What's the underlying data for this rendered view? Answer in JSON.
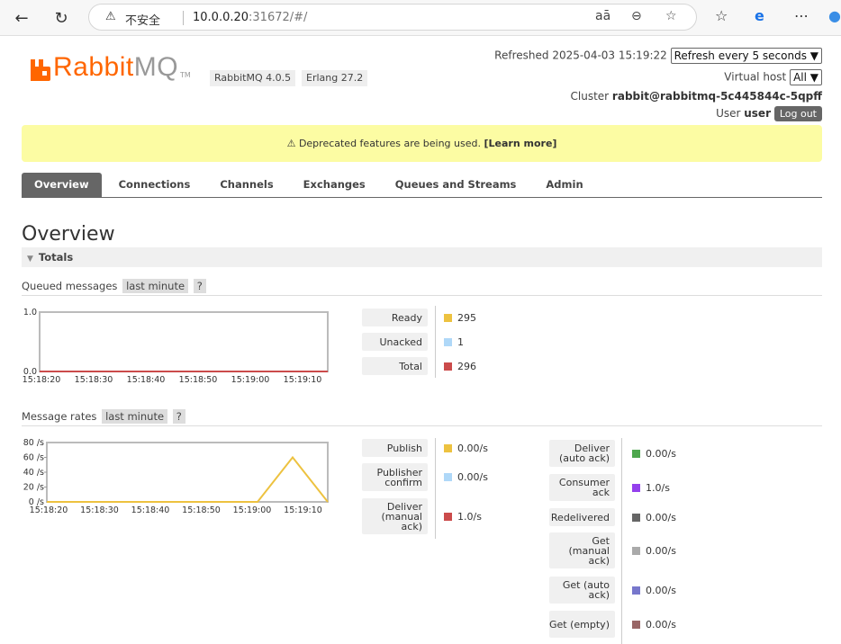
{
  "browser": {
    "insecure_label": "不安全",
    "url_host": "10.0.0.20",
    "url_rest": ":31672/#/"
  },
  "header": {
    "logo_rabbit": "Rabbit",
    "logo_mq": "MQ",
    "logo_tm": "TM",
    "rabbit_version": "RabbitMQ 4.0.5",
    "erlang_version": "Erlang 27.2",
    "refreshed_label": "Refreshed",
    "refreshed_time": "2025-04-03 15:19:22",
    "refresh_select": "Refresh every 5 seconds",
    "vhost_label": "Virtual host",
    "vhost_select": "All",
    "cluster_label": "Cluster",
    "cluster_name": "rabbit@rabbitmq-5c445844c-5qpff",
    "user_label": "User",
    "user_name": "user",
    "logout_label": "Log out"
  },
  "banner": {
    "icon": "⚠",
    "text": "Deprecated features are being used.",
    "link": "[Learn more]"
  },
  "tabs": [
    {
      "label": "Overview",
      "active": true
    },
    {
      "label": "Connections"
    },
    {
      "label": "Channels"
    },
    {
      "label": "Exchanges"
    },
    {
      "label": "Queues and Streams"
    },
    {
      "label": "Admin"
    }
  ],
  "page_title": "Overview",
  "totals_label": "Totals",
  "queued": {
    "heading": "Queued messages",
    "range": "last minute",
    "help": "?",
    "stats": [
      {
        "label": "Ready",
        "value": "295",
        "color": "#edc240"
      },
      {
        "label": "Unacked",
        "value": "1",
        "color": "#afd8f8"
      },
      {
        "label": "Total",
        "value": "296",
        "color": "#cb4b4b"
      }
    ]
  },
  "rates": {
    "heading": "Message rates",
    "range": "last minute",
    "help": "?",
    "left_stats": [
      {
        "label": "Publish",
        "value": "0.00/s",
        "color": "#edc240"
      },
      {
        "label": "Publisher confirm",
        "value": "0.00/s",
        "color": "#afd8f8"
      },
      {
        "label": "Deliver (manual ack)",
        "value": "1.0/s",
        "color": "#cb4b4b"
      }
    ],
    "right_stats": [
      {
        "label": "Deliver (auto ack)",
        "value": "0.00/s",
        "color": "#4da74d"
      },
      {
        "label": "Consumer ack",
        "value": "1.0/s",
        "color": "#9440ed"
      },
      {
        "label": "Redelivered",
        "value": "0.00/s",
        "color": "#666666"
      },
      {
        "label": "Get (manual ack)",
        "value": "0.00/s",
        "color": "#aaaaaa"
      },
      {
        "label": "Get (auto ack)",
        "value": "0.00/s",
        "color": "#7777cc"
      },
      {
        "label": "Get (empty)",
        "value": "0.00/s",
        "color": "#996666"
      }
    ]
  },
  "chart_data": [
    {
      "type": "line",
      "x": [
        "15:18:20",
        "15:18:30",
        "15:18:40",
        "15:18:50",
        "15:19:00",
        "15:19:10"
      ],
      "y_ticks": [
        "1.0",
        "0.0"
      ],
      "ylim": [
        0,
        1
      ],
      "series": [
        {
          "name": "Total",
          "color": "#cb4b4b",
          "values": [
            0,
            0,
            0,
            0,
            0,
            0
          ]
        }
      ]
    },
    {
      "type": "line",
      "x": [
        "15:18:20",
        "15:18:30",
        "15:18:40",
        "15:18:50",
        "15:19:00",
        "15:19:10"
      ],
      "y_ticks": [
        "80 /s",
        "60 /s",
        "40 /s",
        "20 /s",
        "0 /s"
      ],
      "ylim": [
        0,
        80
      ],
      "series": [
        {
          "name": "Publish",
          "color": "#edc240",
          "values": [
            0,
            0,
            0,
            0,
            0,
            0,
            0,
            60,
            0
          ]
        }
      ]
    }
  ]
}
